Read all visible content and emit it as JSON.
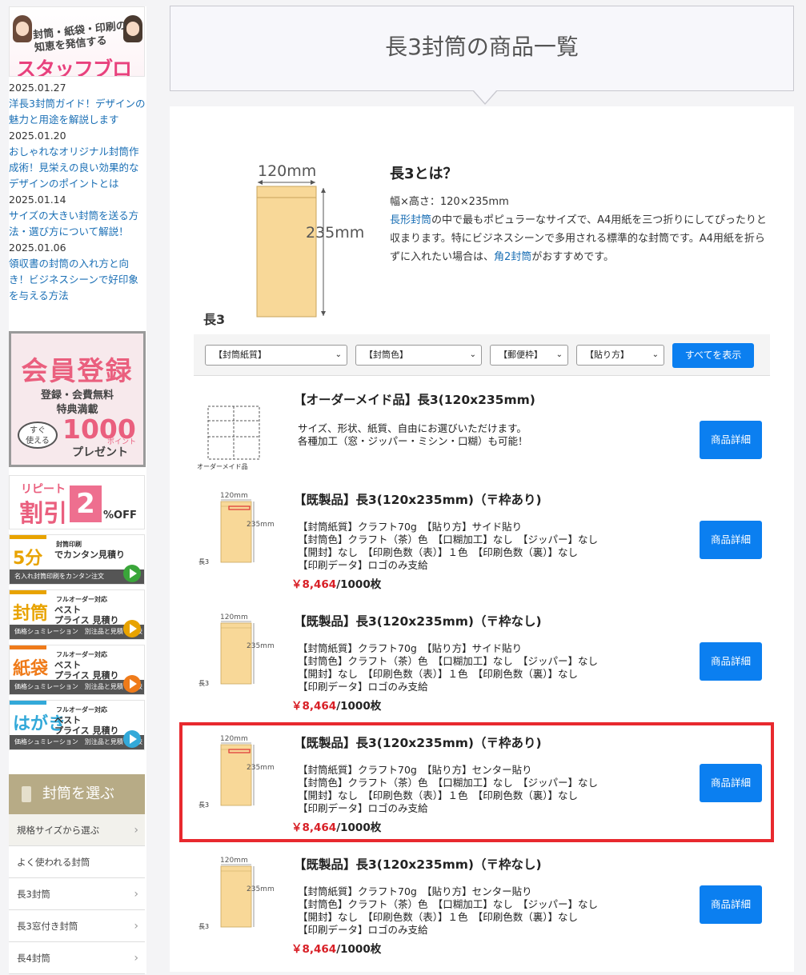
{
  "sidebar": {
    "blog_banner": {
      "top_text": "封筒・紙袋・印刷の\n知恵を発信する",
      "main_text": "スタッフブログ"
    },
    "blog_posts": [
      {
        "date": "2025.01.27",
        "title": "洋長3封筒ガイド！デザインの魅力と用途を解説します"
      },
      {
        "date": "2025.01.20",
        "title": "おしゃれなオリジナル封筒作成術！見栄えの良い効果的なデザインのポイントとは"
      },
      {
        "date": "2025.01.14",
        "title": "サイズの大きい封筒を送る方法・選び方について解説！"
      },
      {
        "date": "2025.01.06",
        "title": "領収書の封筒の入れ方と向き！ビジネスシーンで好印象を与える方法"
      }
    ],
    "member_banner": {
      "title": "会員登録",
      "line1": "登録・会費無料",
      "line2": "特典満載",
      "bubble": "すぐ\n使える",
      "points": "1000",
      "point_unit": "ポイント",
      "present": "プレゼント"
    },
    "repeat_banner": {
      "line1": "リピート",
      "line2": "割引",
      "num": "2",
      "unit": "%OFF"
    },
    "small_banners": [
      {
        "big": "5分",
        "small": "封筒印刷",
        "mid": "でカンタン見積り",
        "bar": "名入れ封筒印刷をカンタン注文",
        "color": "#e8a300",
        "play": "#3aa63a"
      },
      {
        "big": "封筒",
        "small": "フルオーダー対応",
        "mid": "ベスト\nプライス 見積り",
        "bar": "価格シュミレーション　別注品と見積り比較",
        "color": "#e8a300",
        "play": "#e8a300"
      },
      {
        "big": "紙袋",
        "small": "フルオーダー対応",
        "mid": "ベスト\nプライス 見積り",
        "bar": "価格シュミレーション　別注品と見積り比較",
        "color": "#ef7b1a",
        "play": "#ef7b1a"
      },
      {
        "big": "はがき",
        "small": "フルオーダー対応",
        "mid": "ベスト\nプライス 見積り",
        "bar": "価格シュミレーション　別注品と見積り比較",
        "color": "#33a9d9",
        "play": "#33a9d9"
      }
    ],
    "select_header": "封筒を選ぶ",
    "nav_items": [
      {
        "label": "規格サイズから選ぶ",
        "chevron": true
      },
      {
        "label": "よく使われる封筒",
        "chevron": false
      },
      {
        "label": "長3封筒",
        "chevron": true
      },
      {
        "label": "長3窓付き封筒",
        "chevron": true
      },
      {
        "label": "長4封筒",
        "chevron": true
      }
    ]
  },
  "page_title": "長3封筒の商品一覧",
  "intro": {
    "img_width_label": "120mm",
    "img_height_label": "235mm",
    "img_caption": "長3",
    "heading": "長3とは？",
    "size_line": "幅×高さ：120×235mm",
    "link1": "長形封筒",
    "text1": "の中で最もポピュラーなサイズで、A4用紙を三つ折りにしてぴったりと収まります。特にビジネスシーンで多用される標準的な封筒です。A4用紙を折らずに入れたい場合は、",
    "link2": "角2封筒",
    "text2": "がおすすめです。"
  },
  "filters": [
    {
      "label": "【封筒紙質】"
    },
    {
      "label": "【封筒色】"
    },
    {
      "label": "【郵便枠】"
    },
    {
      "label": "【貼り方】"
    }
  ],
  "show_all_label": "すべてを表示",
  "products": [
    {
      "title": "【オーダーメイド品】長3(120x235mm)",
      "desc": "サイズ、形状、紙質、自由にお選びいただけます。\n各種加工（窓・ジッパー・ミシン・口糊）も可能！",
      "price": "",
      "price_unit": "",
      "thumb": "order",
      "thumb_label": "オーダーメイド品",
      "button": "商品詳細"
    },
    {
      "title": "【既製品】長3(120x235mm)（〒枠あり)",
      "desc": "【封筒紙質】クラフト70g　【貼り方】サイド貼り\n【封筒色】クラフト（茶）色　【口糊加工】なし　【ジッパー】なし\n【開封】なし　【印刷色数（表）】１色　【印刷色数（裏）】なし\n【印刷データ】ロゴのみ支給",
      "price": "￥8,464",
      "price_unit": "/1000枚",
      "thumb": "zip",
      "thumb_label": "長3",
      "button": "商品詳細"
    },
    {
      "title": "【既製品】長3(120x235mm)（〒枠なし)",
      "desc": "【封筒紙質】クラフト70g　【貼り方】サイド貼り\n【封筒色】クラフト（茶）色　【口糊加工】なし　【ジッパー】なし\n【開封】なし　【印刷色数（表）】１色　【印刷色数（裏）】なし\n【印刷データ】ロゴのみ支給",
      "price": "￥8,464",
      "price_unit": "/1000枚",
      "thumb": "plain",
      "thumb_label": "長3",
      "button": "商品詳細"
    },
    {
      "title": "【既製品】長3(120x235mm)（〒枠あり)",
      "desc": "【封筒紙質】クラフト70g　【貼り方】センター貼り\n【封筒色】クラフト（茶）色　【口糊加工】なし　【ジッパー】なし\n【開封】なし　【印刷色数（表）】１色　【印刷色数（裏）】なし\n【印刷データ】ロゴのみ支給",
      "price": "￥8,464",
      "price_unit": "/1000枚",
      "thumb": "zip",
      "thumb_label": "長3",
      "button": "商品詳細"
    },
    {
      "title": "【既製品】長3(120x235mm)（〒枠なし)",
      "desc": "【封筒紙質】クラフト70g　【貼り方】センター貼り\n【封筒色】クラフト（茶）色　【口糊加工】なし　【ジッパー】なし\n【開封】なし　【印刷色数（表）】１色　【印刷色数（裏）】なし\n【印刷データ】ロゴのみ支給",
      "price": "￥8,464",
      "price_unit": "/1000枚",
      "thumb": "plain",
      "thumb_label": "長3",
      "button": "商品詳細"
    }
  ],
  "thumb_labels": {
    "width": "120mm",
    "height": "235mm"
  },
  "colors": {
    "accent": "#0b7ff0",
    "price": "#d81f26",
    "highlight": "#e8292e",
    "envelope": "#f8d898"
  }
}
